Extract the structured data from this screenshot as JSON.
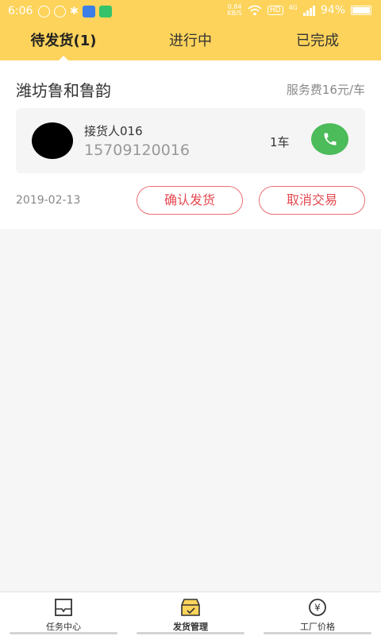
{
  "status_bar": {
    "time": "6:06",
    "net_speed_value": "0.84",
    "net_speed_unit": "KB/S",
    "hd": "HD",
    "network": "4G",
    "battery": "94%"
  },
  "tabs": [
    {
      "label": "待发货(1)",
      "active": true
    },
    {
      "label": "进行中",
      "active": false
    },
    {
      "label": "已完成",
      "active": false
    }
  ],
  "order": {
    "shop_name": "潍坊鲁和鲁韵",
    "service_fee": "服务费16元/车",
    "receiver_name": "接货人016",
    "receiver_phone": "15709120016",
    "quantity": "1车",
    "date": "2019-02-13",
    "confirm_label": "确认发货",
    "cancel_label": "取消交易"
  },
  "bottom_nav": [
    {
      "label": "任务中心",
      "icon": "task-center-icon",
      "active": false
    },
    {
      "label": "发货管理",
      "icon": "shipping-management-icon",
      "active": true
    },
    {
      "label": "工厂价格",
      "icon": "yuan-price-icon",
      "active": false
    }
  ],
  "colors": {
    "accent_yellow": "#fdd35b",
    "call_green": "#4cbb5a",
    "action_red": "#e5484f"
  }
}
